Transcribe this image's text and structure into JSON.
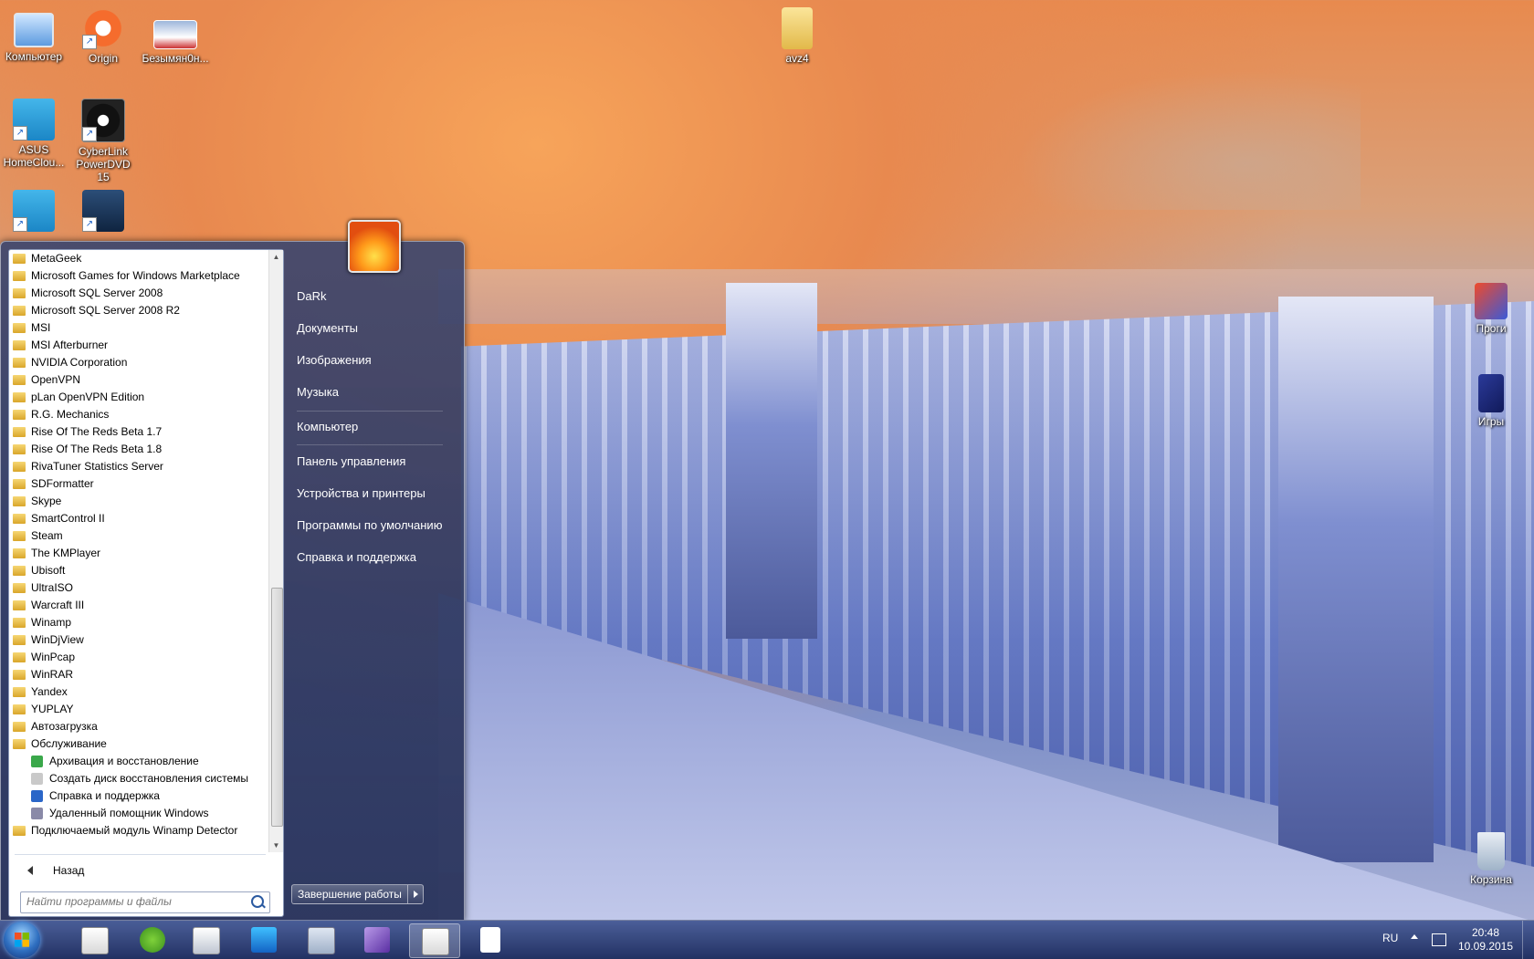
{
  "desktop": {
    "icons_left": [
      {
        "label": "Компьютер",
        "icon": "computer-icon"
      },
      {
        "label": "Origin",
        "icon": "origin-icon"
      },
      {
        "label": "Безымян0н...",
        "icon": "image-file-icon"
      },
      {
        "label": "ASUS HomeClou...",
        "icon": "asus-homecloud-icon"
      },
      {
        "label": "CyberLink PowerDVD 15",
        "icon": "powerdvd-icon"
      }
    ],
    "icon_folder": {
      "label": "avz4"
    },
    "icons_right": [
      {
        "label": "Проги"
      },
      {
        "label": "Игры"
      },
      {
        "label": "Корзина"
      }
    ]
  },
  "start_menu": {
    "programs": [
      {
        "label": "MetaGeek",
        "type": "folder"
      },
      {
        "label": "Microsoft Games for Windows Marketplace",
        "type": "folder"
      },
      {
        "label": "Microsoft SQL Server 2008",
        "type": "folder"
      },
      {
        "label": "Microsoft SQL Server 2008 R2",
        "type": "folder"
      },
      {
        "label": "MSI",
        "type": "folder"
      },
      {
        "label": "MSI Afterburner",
        "type": "folder"
      },
      {
        "label": "NVIDIA Corporation",
        "type": "folder"
      },
      {
        "label": "OpenVPN",
        "type": "folder"
      },
      {
        "label": "pLan OpenVPN Edition",
        "type": "folder"
      },
      {
        "label": "R.G. Mechanics",
        "type": "folder"
      },
      {
        "label": "Rise Of The Reds Beta 1.7",
        "type": "folder"
      },
      {
        "label": "Rise Of The Reds Beta 1.8",
        "type": "folder"
      },
      {
        "label": "RivaTuner Statistics Server",
        "type": "folder"
      },
      {
        "label": "SDFormatter",
        "type": "folder"
      },
      {
        "label": "Skype",
        "type": "folder"
      },
      {
        "label": "SmartControl II",
        "type": "folder"
      },
      {
        "label": "Steam",
        "type": "folder"
      },
      {
        "label": "The KMPlayer",
        "type": "folder"
      },
      {
        "label": "Ubisoft",
        "type": "folder"
      },
      {
        "label": "UltraISO",
        "type": "folder"
      },
      {
        "label": "Warcraft III",
        "type": "folder"
      },
      {
        "label": "Winamp",
        "type": "folder"
      },
      {
        "label": "WinDjView",
        "type": "folder"
      },
      {
        "label": "WinPcap",
        "type": "folder"
      },
      {
        "label": "WinRAR",
        "type": "folder"
      },
      {
        "label": "Yandex",
        "type": "folder"
      },
      {
        "label": "YUPLAY",
        "type": "folder"
      },
      {
        "label": "Автозагрузка",
        "type": "folder"
      },
      {
        "label": "Обслуживание",
        "type": "folder"
      },
      {
        "label": "Архивация и восстановление",
        "type": "sub",
        "color": "#3aa84a"
      },
      {
        "label": "Создать диск восстановления системы",
        "type": "sub",
        "color": "#c9c9c9"
      },
      {
        "label": "Справка и поддержка",
        "type": "sub",
        "color": "#2a66c8"
      },
      {
        "label": "Удаленный помощник Windows",
        "type": "sub",
        "color": "#8a8aa8"
      },
      {
        "label": "Подключаемый модуль Winamp Detector",
        "type": "folder"
      }
    ],
    "back_label": "Назад",
    "search_placeholder": "Найти программы и файлы",
    "right_items": [
      "DaRk",
      "Документы",
      "Изображения",
      "Музыка",
      "Компьютер",
      "Панель управления",
      "Устройства и принтеры",
      "Программы по умолчанию",
      "Справка и поддержка"
    ],
    "shutdown_label": "Завершение работы"
  },
  "taskbar": {
    "language": "RU",
    "time": "20:48",
    "date": "10.09.2015"
  }
}
